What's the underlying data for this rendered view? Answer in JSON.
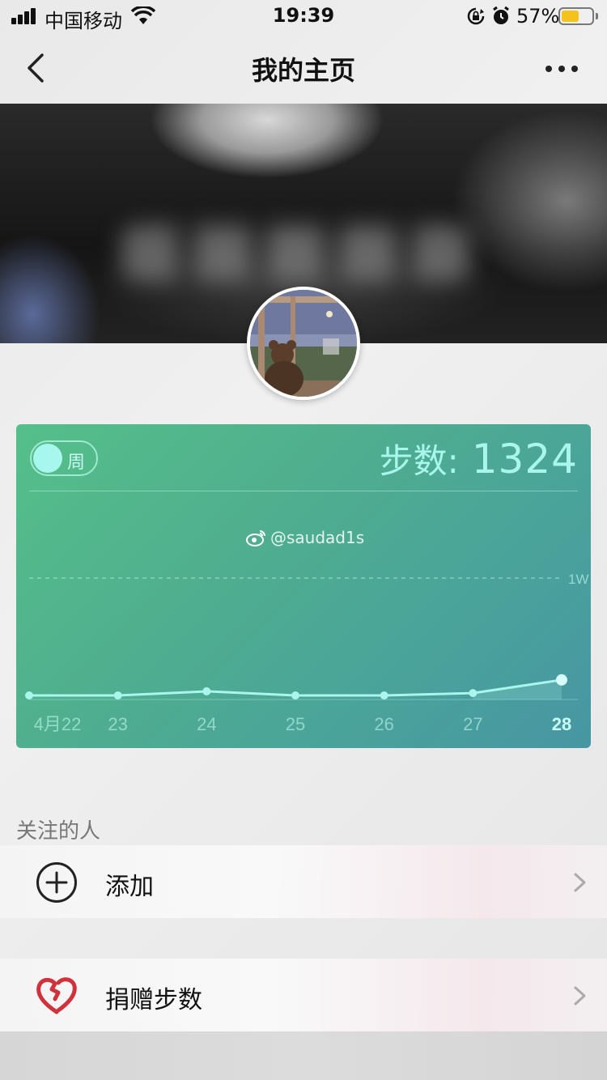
{
  "status_bar": {
    "carrier": "中国移动",
    "time": "19:39",
    "battery_percent": "57%",
    "battery_level": 0.57
  },
  "nav": {
    "title": "我的主页"
  },
  "card": {
    "toggle_label": "周",
    "steps_label": "步数",
    "steps_colon": ":",
    "steps_value": "1324",
    "watermark": "@saudad1s",
    "colors": {
      "accent_line": "#a9f6ec",
      "card_start": "#55bf8a",
      "card_end": "#4796a3"
    }
  },
  "chart_data": {
    "type": "line",
    "categories": [
      "4月22",
      "23",
      "24",
      "25",
      "26",
      "27",
      "28"
    ],
    "series": [
      {
        "values": [
          0,
          0,
          350,
          0,
          0,
          200,
          1324
        ]
      }
    ],
    "reference_label": "1W",
    "reference_value": 10000,
    "ylim": [
      0,
      10000
    ],
    "highlight_index": 6
  },
  "follow": {
    "section_label": "关注的人",
    "add_label": "添加",
    "donate_label": "捐赠步数"
  }
}
